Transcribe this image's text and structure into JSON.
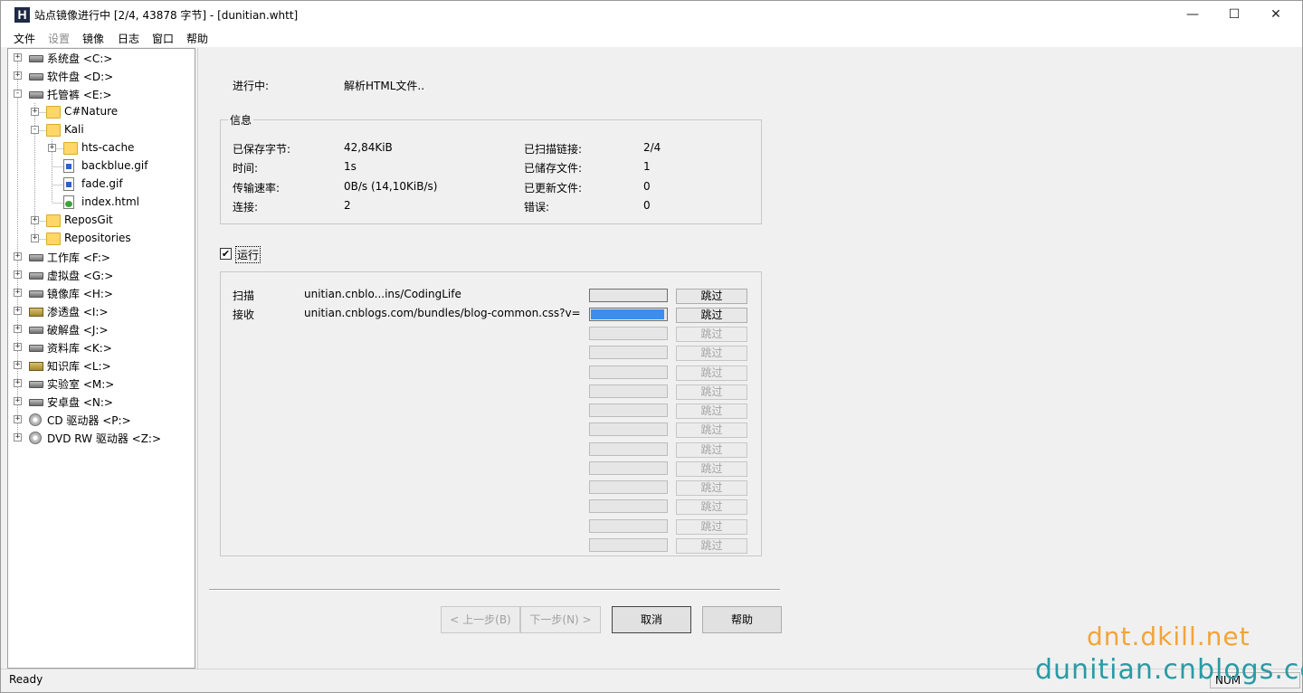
{
  "window": {
    "app_icon_letter": "H",
    "title": "站点镜像进行中 [2/4, 43878 字节] - [dunitian.whtt]",
    "minimize_glyph": "—",
    "maximize_glyph": "☐",
    "close_glyph": "✕"
  },
  "menu": {
    "items": [
      "文件",
      "设置",
      "镜像",
      "日志",
      "窗口",
      "帮助"
    ],
    "disabled": [
      "设置"
    ]
  },
  "tree": {
    "items": [
      {
        "label": "系统盘 <C:>",
        "icon": "system-drive-icon",
        "expander": "+"
      },
      {
        "label": "软件盘 <D:>",
        "icon": "drive-icon",
        "expander": "+"
      },
      {
        "label": "托管裤 <E:>",
        "icon": "drive-icon",
        "expander": "-"
      },
      {
        "label": "C#Nature",
        "icon": "folder-icon",
        "expander": "+"
      },
      {
        "label": "Kali",
        "icon": "folder-icon",
        "expander": "-"
      },
      {
        "label": "hts-cache",
        "icon": "folder-icon",
        "expander": "+"
      },
      {
        "label": "backblue.gif",
        "icon": "image-file-icon",
        "expander": ""
      },
      {
        "label": "fade.gif",
        "icon": "image-file-icon",
        "expander": ""
      },
      {
        "label": "index.html",
        "icon": "html-file-icon",
        "expander": ""
      },
      {
        "label": "ReposGit",
        "icon": "folder-icon",
        "expander": "+"
      },
      {
        "label": "Repositories",
        "icon": "folder-icon",
        "expander": "+"
      },
      {
        "label": "工作库 <F:>",
        "icon": "drive-icon",
        "expander": "+"
      },
      {
        "label": "虚拟盘 <G:>",
        "icon": "drive-icon",
        "expander": "+"
      },
      {
        "label": "镜像库 <H:>",
        "icon": "drive-icon",
        "expander": "+"
      },
      {
        "label": "渗透盘 <I:>",
        "icon": "locked-drive-icon",
        "expander": "+"
      },
      {
        "label": "破解盘 <J:>",
        "icon": "drive-icon",
        "expander": "+"
      },
      {
        "label": "资料库 <K:>",
        "icon": "drive-icon",
        "expander": "+"
      },
      {
        "label": "知识库 <L:>",
        "icon": "locked-drive-icon",
        "expander": "+"
      },
      {
        "label": "实验室 <M:>",
        "icon": "drive-icon",
        "expander": "+"
      },
      {
        "label": "安卓盘 <N:>",
        "icon": "drive-icon",
        "expander": "+"
      },
      {
        "label": "CD 驱动器 <P:>",
        "icon": "cd-drive-icon",
        "expander": "+"
      },
      {
        "label": "DVD RW 驱动器 <Z:>",
        "icon": "cd-drive-icon",
        "expander": "+"
      }
    ]
  },
  "progress": {
    "label": "进行中:",
    "value": "解析HTML文件.."
  },
  "info": {
    "legend": "信息",
    "left": [
      {
        "label": "已保存字节:",
        "value": "42,84KiB"
      },
      {
        "label": "时间:",
        "value": "1s"
      },
      {
        "label": "传输速率:",
        "value": "0B/s (14,10KiB/s)"
      },
      {
        "label": "连接:",
        "value": "2"
      }
    ],
    "right": [
      {
        "label": "已扫描链接:",
        "value": "2/4"
      },
      {
        "label": "已储存文件:",
        "value": "1"
      },
      {
        "label": "已更新文件:",
        "value": "0"
      },
      {
        "label": "错误:",
        "value": "0"
      }
    ]
  },
  "run": {
    "label": "运行",
    "checked": true,
    "check_glyph": "✔"
  },
  "transfers": {
    "skip_label": "跳过",
    "rows": [
      {
        "action": "扫描",
        "url": "unitian.cnblo...ins/CodingLife",
        "progress": 0.0,
        "skip_enabled": true
      },
      {
        "action": "接收",
        "url": "unitian.cnblogs.com/bundles/blog-common.css?v=x(",
        "progress": 0.97,
        "skip_enabled": true
      },
      {
        "action": "",
        "url": "",
        "progress": 0,
        "skip_enabled": false
      },
      {
        "action": "",
        "url": "",
        "progress": 0,
        "skip_enabled": false
      },
      {
        "action": "",
        "url": "",
        "progress": 0,
        "skip_enabled": false
      },
      {
        "action": "",
        "url": "",
        "progress": 0,
        "skip_enabled": false
      },
      {
        "action": "",
        "url": "",
        "progress": 0,
        "skip_enabled": false
      },
      {
        "action": "",
        "url": "",
        "progress": 0,
        "skip_enabled": false
      },
      {
        "action": "",
        "url": "",
        "progress": 0,
        "skip_enabled": false
      },
      {
        "action": "",
        "url": "",
        "progress": 0,
        "skip_enabled": false
      },
      {
        "action": "",
        "url": "",
        "progress": 0,
        "skip_enabled": false
      },
      {
        "action": "",
        "url": "",
        "progress": 0,
        "skip_enabled": false
      },
      {
        "action": "",
        "url": "",
        "progress": 0,
        "skip_enabled": false
      },
      {
        "action": "",
        "url": "",
        "progress": 0,
        "skip_enabled": false
      }
    ]
  },
  "buttons": {
    "back": "< 上一步(B)",
    "next": "下一步(N) >",
    "cancel": "取消",
    "help": "帮助"
  },
  "status": {
    "text": "Ready",
    "num": "NUM"
  },
  "watermark": {
    "line1": "dnt.dkill.net",
    "line2": "dunitian.cnblogs.com"
  },
  "colors": {
    "progress_fill": "#3b8df0",
    "watermark_orange": "#f2a43a",
    "watermark_teal": "#2a9aa5"
  }
}
